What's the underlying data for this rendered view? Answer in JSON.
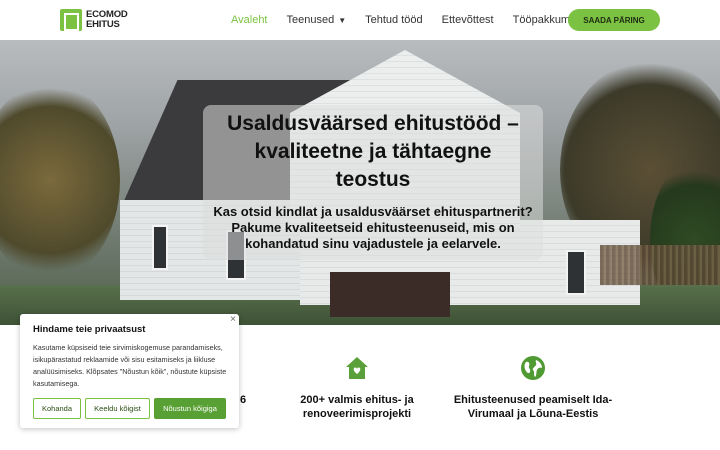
{
  "header": {
    "logo_line1": "ECOMOD",
    "logo_line2": "EHITUS",
    "nav": [
      {
        "label": "Avaleht"
      },
      {
        "label": "Teenused"
      },
      {
        "label": "Tehtud tööd"
      },
      {
        "label": "Ettevõttest"
      },
      {
        "label": "Tööpakkumised"
      }
    ],
    "cta_label": "SAADA PÄRING"
  },
  "hero": {
    "title": "Usaldusväärsed ehitustööd – kvaliteetne ja tähtaegne teostus",
    "subtitle": "Kas otsid kindlat ja usaldusväärset ehituspartnerit? Pakume kvaliteetseid ehitusteenuseid, mis on kohandatud sinu vajadustele ja eelarvele."
  },
  "features": [
    {
      "text": "6",
      "icon": "partial-hidden"
    },
    {
      "text": "200+ valmis ehitus- ja renoveerimisprojekti",
      "icon": "house-heart-icon"
    },
    {
      "text": "Ehitusteenused peamiselt Ida-Virumaal ja Lõuna-Eestis",
      "icon": "globe-icon"
    }
  ],
  "cookie": {
    "title": "Hindame teie privaatsust",
    "text": "Kasutame küpsiseid teie sirvimiskogemuse parandamiseks, isikupärastatud reklaamide või sisu esitamiseks ja liikluse analüüsimiseks. Klõpsates \"Nõustun kõik\", nõustute küpsiste kasutamisega.",
    "btn_customize": "Kohanda",
    "btn_reject": "Keeldu kõigist",
    "btn_accept": "Nõustun kõigiga",
    "close": "×"
  },
  "colors": {
    "accent": "#7cc242",
    "accent_dark": "#58a033",
    "text": "#111111"
  }
}
